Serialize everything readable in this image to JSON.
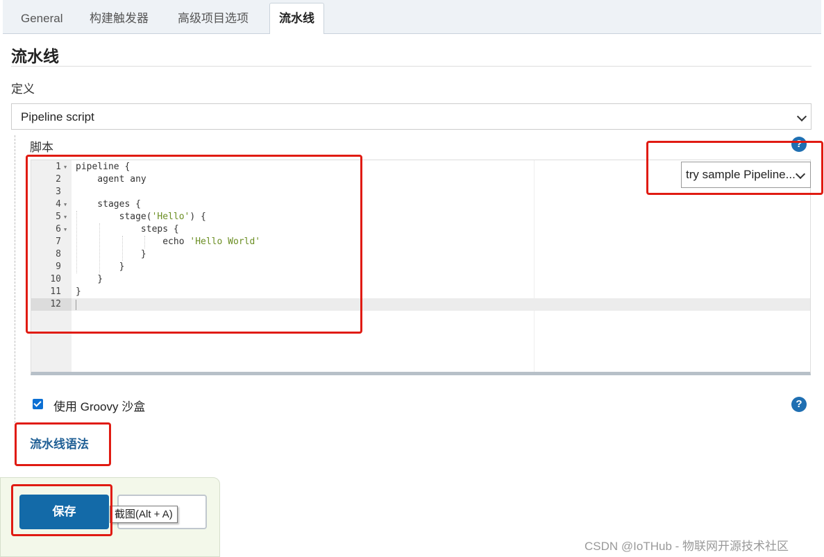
{
  "tabs": [
    {
      "label": "General",
      "active": false
    },
    {
      "label": "构建触发器",
      "active": false
    },
    {
      "label": "高级项目选项",
      "active": false
    },
    {
      "label": "流水线",
      "active": true
    }
  ],
  "section": {
    "title": "流水线",
    "definition_label": "定义",
    "definition_value": "Pipeline script",
    "script_label": "脚本",
    "help_icon": "question-circle-icon"
  },
  "editor": {
    "lines": [
      {
        "num": "1",
        "fold": true,
        "text": "pipeline {"
      },
      {
        "num": "2",
        "fold": false,
        "text": "    agent any"
      },
      {
        "num": "3",
        "fold": false,
        "text": ""
      },
      {
        "num": "4",
        "fold": true,
        "text": "    stages {"
      },
      {
        "num": "5",
        "fold": true,
        "text": "        stage(",
        "str": "'Hello'",
        "after": ") {"
      },
      {
        "num": "6",
        "fold": true,
        "text": "            steps {"
      },
      {
        "num": "7",
        "fold": false,
        "text": "                echo ",
        "str": "'Hello World'",
        "after": ""
      },
      {
        "num": "8",
        "fold": false,
        "text": "            }"
      },
      {
        "num": "9",
        "fold": false,
        "text": "        }"
      },
      {
        "num": "10",
        "fold": false,
        "text": "    }"
      },
      {
        "num": "11",
        "fold": false,
        "text": "}"
      },
      {
        "num": "12",
        "fold": false,
        "text": ""
      }
    ],
    "active_line": "12"
  },
  "sample_select": {
    "value": "try sample Pipeline..."
  },
  "groovy_sandbox": {
    "label": "使用 Groovy 沙盒",
    "checked": true
  },
  "pipeline_syntax_link": "流水线语法",
  "footer": {
    "save_label": "保存",
    "tooltip": "截图(Alt + A)"
  },
  "watermark": "CSDN @IoTHub - 物联网开源技术社区",
  "colors": {
    "accent": "#136aa8",
    "annotation": "#e01b12",
    "string": "#6b8e23"
  }
}
